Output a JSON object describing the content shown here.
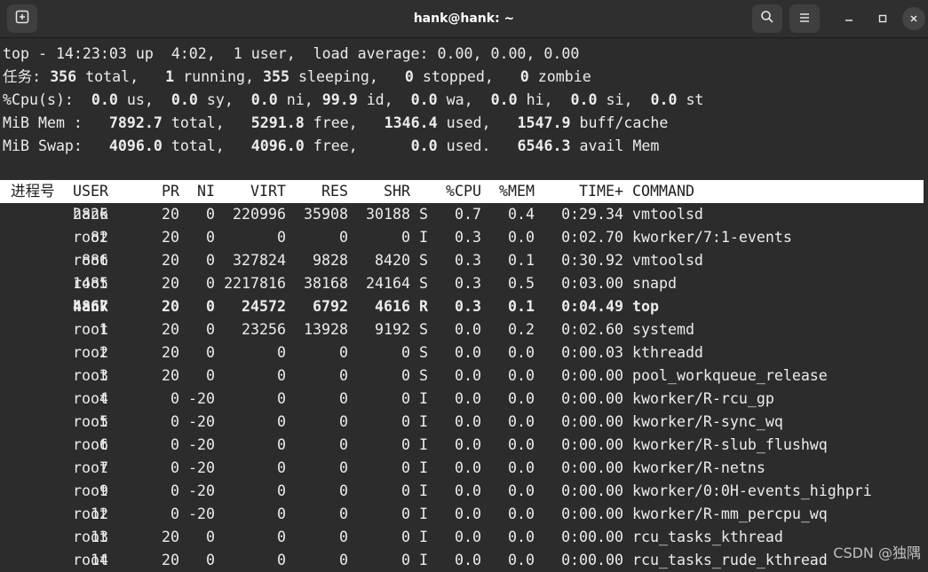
{
  "window": {
    "title": "hank@hank: ~",
    "new_tab_icon": "new-tab-icon",
    "search_icon": "search-icon",
    "menu_icon": "hamburger-menu-icon",
    "minimize_icon": "minimize-icon",
    "maximize_icon": "maximize-icon",
    "close_icon": "close-icon"
  },
  "summary": {
    "line1": "top - 14:23:03 up  4:02,  1 user,  load average: 0.00, 0.00, 0.00",
    "tasks": {
      "label": "任务:",
      "total_val": "356",
      "total_lbl": " total,",
      "running_val": "1",
      "running_lbl": " running,",
      "sleeping_val": "355",
      "sleeping_lbl": " sleeping,",
      "stopped_val": "0",
      "stopped_lbl": " stopped,",
      "zombie_val": "0",
      "zombie_lbl": " zombie"
    },
    "cpu": {
      "label": "%Cpu(s):",
      "us": "0.0",
      "sy": "0.0",
      "ni": "0.0",
      "id": "99.9",
      "wa": "0.0",
      "hi": "0.0",
      "si": "0.0",
      "st": "0.0"
    },
    "mem": {
      "label": "MiB Mem :",
      "total": "7892.7",
      "free": "5291.8",
      "used": "1346.4",
      "buff_cache": "1547.9"
    },
    "swap": {
      "label": "MiB Swap:",
      "total": "4096.0",
      "free": "4096.0",
      "used": "0.0",
      "avail": "6546.3"
    }
  },
  "table": {
    "headers": [
      "进程号",
      "USER",
      "PR",
      "NI",
      "VIRT",
      "RES",
      "SHR",
      "",
      "%CPU",
      "%MEM",
      "TIME+",
      "COMMAND"
    ],
    "rows": [
      [
        "2826",
        "hank",
        "20",
        "0",
        "220996",
        "35908",
        "30188",
        "S",
        "0.7",
        "0.4",
        "0:29.34",
        "vmtoolsd"
      ],
      [
        "82",
        "root",
        "20",
        "0",
        "0",
        "0",
        "0",
        "I",
        "0.3",
        "0.0",
        "0:02.70",
        "kworker/7:1-events"
      ],
      [
        "886",
        "root",
        "20",
        "0",
        "327824",
        "9828",
        "8420",
        "S",
        "0.3",
        "0.1",
        "0:30.92",
        "vmtoolsd"
      ],
      [
        "1485",
        "root",
        "20",
        "0",
        "2217816",
        "38168",
        "24164",
        "S",
        "0.3",
        "0.5",
        "0:03.00",
        "snapd"
      ],
      [
        "4867",
        "hank",
        "20",
        "0",
        "24572",
        "6792",
        "4616",
        "R",
        "0.3",
        "0.1",
        "0:04.49",
        "top"
      ],
      [
        "1",
        "root",
        "20",
        "0",
        "23256",
        "13928",
        "9192",
        "S",
        "0.0",
        "0.2",
        "0:02.60",
        "systemd"
      ],
      [
        "2",
        "root",
        "20",
        "0",
        "0",
        "0",
        "0",
        "S",
        "0.0",
        "0.0",
        "0:00.03",
        "kthreadd"
      ],
      [
        "3",
        "root",
        "20",
        "0",
        "0",
        "0",
        "0",
        "S",
        "0.0",
        "0.0",
        "0:00.00",
        "pool_workqueue_release"
      ],
      [
        "4",
        "root",
        "0",
        "-20",
        "0",
        "0",
        "0",
        "I",
        "0.0",
        "0.0",
        "0:00.00",
        "kworker/R-rcu_gp"
      ],
      [
        "5",
        "root",
        "0",
        "-20",
        "0",
        "0",
        "0",
        "I",
        "0.0",
        "0.0",
        "0:00.00",
        "kworker/R-sync_wq"
      ],
      [
        "6",
        "root",
        "0",
        "-20",
        "0",
        "0",
        "0",
        "I",
        "0.0",
        "0.0",
        "0:00.00",
        "kworker/R-slub_flushwq"
      ],
      [
        "7",
        "root",
        "0",
        "-20",
        "0",
        "0",
        "0",
        "I",
        "0.0",
        "0.0",
        "0:00.00",
        "kworker/R-netns"
      ],
      [
        "9",
        "root",
        "0",
        "-20",
        "0",
        "0",
        "0",
        "I",
        "0.0",
        "0.0",
        "0:00.00",
        "kworker/0:0H-events_highpri"
      ],
      [
        "12",
        "root",
        "0",
        "-20",
        "0",
        "0",
        "0",
        "I",
        "0.0",
        "0.0",
        "0:00.00",
        "kworker/R-mm_percpu_wq"
      ],
      [
        "13",
        "root",
        "20",
        "0",
        "0",
        "0",
        "0",
        "I",
        "0.0",
        "0.0",
        "0:00.00",
        "rcu_tasks_kthread"
      ],
      [
        "14",
        "root",
        "20",
        "0",
        "0",
        "0",
        "0",
        "I",
        "0.0",
        "0.0",
        "0:00.00",
        "rcu_tasks_rude_kthread"
      ]
    ],
    "highlighted_pid": "4867"
  },
  "watermark": "CSDN @独隅",
  "colors": {
    "terminal_bg": "#2c2c2c",
    "terminal_fg": "#ececec",
    "header_bg": "#ffffff",
    "header_fg": "#1e1e1e"
  }
}
